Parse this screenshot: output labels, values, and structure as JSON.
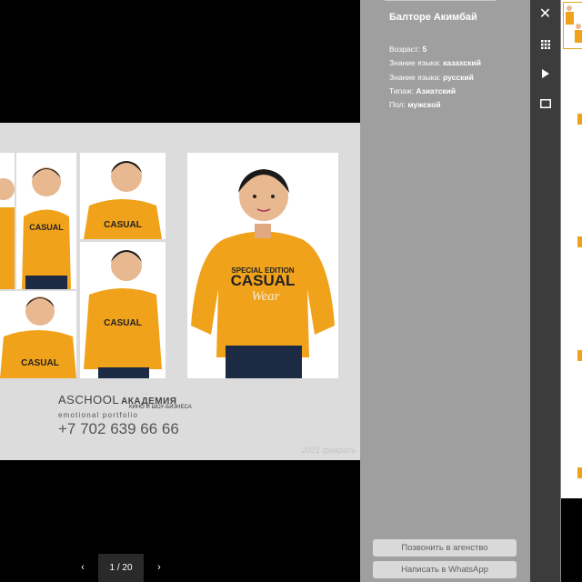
{
  "profile": {
    "name": "Балторе Акимбай",
    "fields": [
      {
        "label": "Возраст:",
        "value": "5"
      },
      {
        "label": "Знание языка:",
        "value": "казахский"
      },
      {
        "label": "Знание языка:",
        "value": "русский"
      },
      {
        "label": "Типаж:",
        "value": "Азиатский"
      },
      {
        "label": "Пол:",
        "value": "мужской"
      }
    ]
  },
  "actions": {
    "call_label": "Позвонить в агенство",
    "whatsapp_label": "Написать в WhatsApp"
  },
  "slide": {
    "brand_line1": "ASCHOOL",
    "brand_line1_bold": "АКАДЕМИЯ",
    "brand_line2": "КИНО И ШОУ-БИЗНЕСА",
    "brand_line3": "emotional portfolio",
    "phone": "+7 702 639 66 66",
    "date_note": "2021 февраль",
    "shirt_text_top": "SPECIAL EDITION",
    "shirt_text_main": "CASUAL",
    "shirt_text_script": "Wear"
  },
  "pager": {
    "counter": "1 / 20",
    "prev_icon": "chevron-left-icon",
    "next_icon": "chevron-right-icon"
  },
  "toolbar": {
    "icons": [
      "close-icon",
      "grid-icon",
      "play-icon",
      "fullscreen-icon"
    ]
  },
  "colors": {
    "shirt": "#f0a21b",
    "info_panel": "#9f9f9f",
    "toolbar": "#3c3c3c",
    "sheet": "#dcdcdc"
  }
}
